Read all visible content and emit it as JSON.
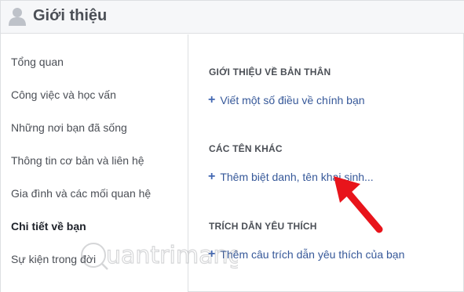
{
  "header": {
    "title": "Giới thiệu",
    "icon": "user-silhouette-icon"
  },
  "sidebar": {
    "items": [
      {
        "label": "Tổng quan",
        "active": false
      },
      {
        "label": "Công việc và học vấn",
        "active": false
      },
      {
        "label": "Những nơi bạn đã sống",
        "active": false
      },
      {
        "label": "Thông tin cơ bản và liên hệ",
        "active": false
      },
      {
        "label": "Gia đình và các mối quan hệ",
        "active": false
      },
      {
        "label": "Chi tiết về bạn",
        "active": true
      },
      {
        "label": "Sự kiện trong đời",
        "active": false
      }
    ]
  },
  "main": {
    "sections": [
      {
        "title": "GIỚI THIỆU VỀ BẢN THÂN",
        "link": "Viết một số điều về chính bạn"
      },
      {
        "title": "CÁC TÊN KHÁC",
        "link": "Thêm biệt danh, tên khai sinh..."
      },
      {
        "title": "TRÍCH DẪN YÊU THÍCH",
        "link": "Thêm câu trích dẫn yêu thích của bạn"
      }
    ],
    "plus_symbol": "+"
  },
  "annotation": {
    "arrow_color": "#e8141b"
  },
  "watermark": {
    "text": "uantrimang"
  },
  "colors": {
    "link": "#365899",
    "header_bg": "#f6f7f9",
    "text": "#4b4f56"
  }
}
